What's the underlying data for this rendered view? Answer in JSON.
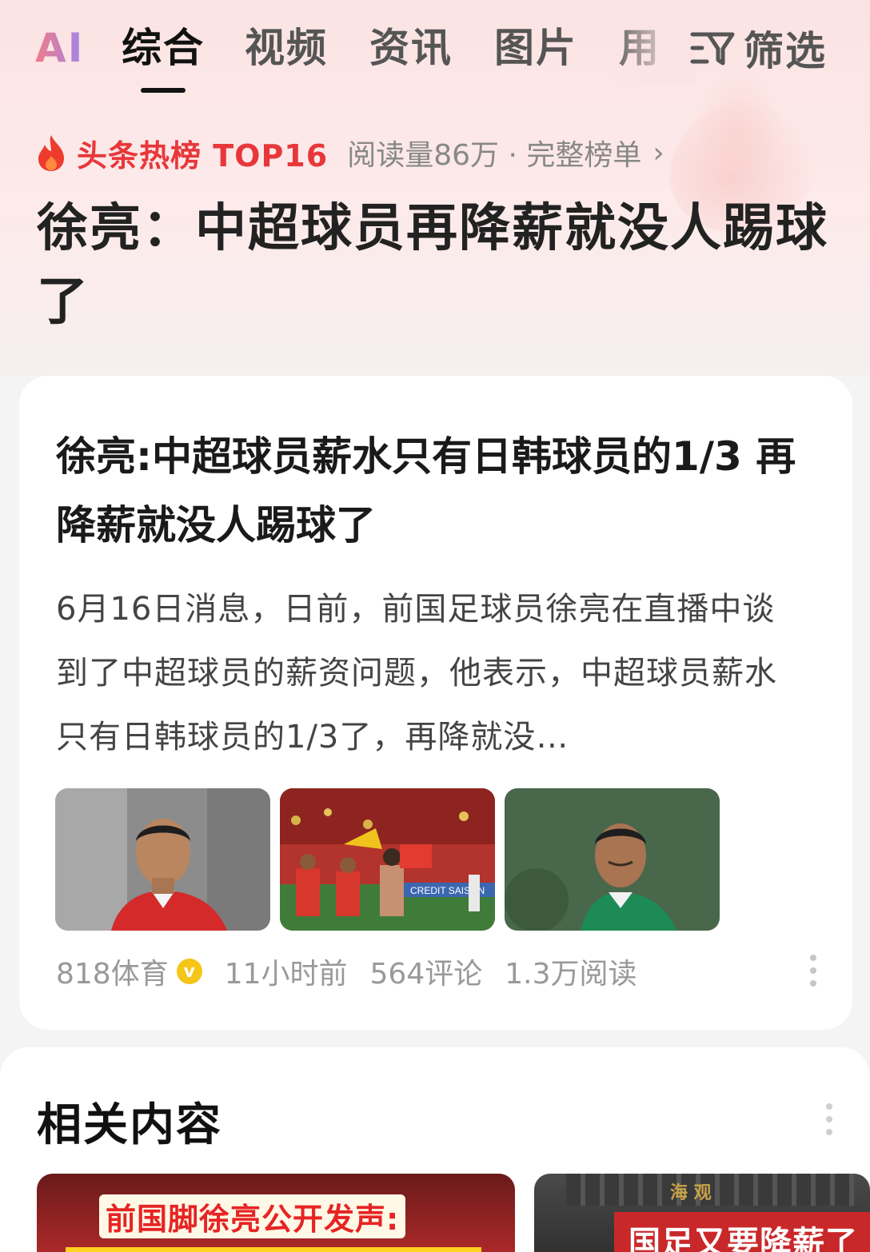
{
  "tabs": {
    "ai": "AI",
    "items": [
      "综合",
      "视频",
      "资讯",
      "图片",
      "用"
    ],
    "active_index": 0,
    "filter_label": "筛选"
  },
  "hot": {
    "title": "头条热榜 TOP16",
    "meta": "阅读量86万 · 完整榜单"
  },
  "headline": "徐亮：中超球员再降薪就没人踢球了",
  "card": {
    "title": "徐亮:中超球员薪水只有日韩球员的1/3 再降薪就没人踢球了",
    "summary": "6月16日消息，日前，前国足球员徐亮在直播中谈到了中超球员的薪资问题，他表示，中超球员薪水只有日韩球员的1/3了，再降就没…",
    "thumbs": [
      "player-portrait",
      "team-celebration",
      "player-grimace"
    ],
    "thumb_banner_text": "CREDIT SAISON",
    "source": "818体育",
    "verified_badge": "v",
    "time": "11小时前",
    "comments": "564评论",
    "reads": "1.3万阅读"
  },
  "related": {
    "title": "相关内容",
    "items": [
      {
        "caption": "前国脚徐亮公开发声:"
      },
      {
        "caption": "国足又要降薪了",
        "sign_text": "海 观"
      }
    ]
  },
  "colors": {
    "hot_red": "#e8373a",
    "accent_gradient_start": "#f07b8a",
    "accent_gradient_end": "#9f86e8"
  }
}
